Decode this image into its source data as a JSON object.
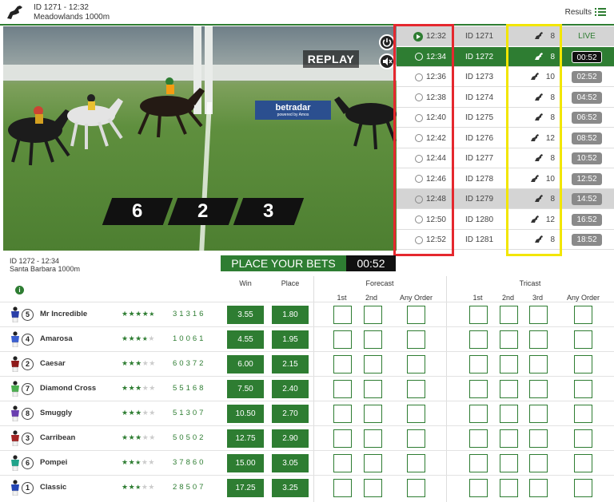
{
  "header": {
    "race_id": "ID 1271 - 12:32",
    "venue": "Meadowlands 1000m",
    "results_label": "Results"
  },
  "video": {
    "replay_label": "REPLAY",
    "placings": [
      "6",
      "2",
      "3"
    ],
    "ad_text": "betradar",
    "ad_subtext": "powered by Amos"
  },
  "schedule": [
    {
      "time": "12:32",
      "id": "ID 1271",
      "runners": "8",
      "status": "LIVE",
      "state": "live"
    },
    {
      "time": "12:34",
      "id": "ID 1272",
      "runners": "8",
      "status": "00:52",
      "state": "current"
    },
    {
      "time": "12:36",
      "id": "ID 1273",
      "runners": "10",
      "status": "02:52",
      "state": "upcoming"
    },
    {
      "time": "12:38",
      "id": "ID 1274",
      "runners": "8",
      "status": "04:52",
      "state": "upcoming"
    },
    {
      "time": "12:40",
      "id": "ID 1275",
      "runners": "8",
      "status": "06:52",
      "state": "upcoming"
    },
    {
      "time": "12:42",
      "id": "ID 1276",
      "runners": "12",
      "status": "08:52",
      "state": "upcoming"
    },
    {
      "time": "12:44",
      "id": "ID 1277",
      "runners": "8",
      "status": "10:52",
      "state": "upcoming"
    },
    {
      "time": "12:46",
      "id": "ID 1278",
      "runners": "10",
      "status": "12:52",
      "state": "upcoming"
    },
    {
      "time": "12:48",
      "id": "ID 1279",
      "runners": "8",
      "status": "14:52",
      "state": "grey"
    },
    {
      "time": "12:50",
      "id": "ID 1280",
      "runners": "12",
      "status": "16:52",
      "state": "upcoming"
    },
    {
      "time": "12:52",
      "id": "ID 1281",
      "runners": "8",
      "status": "18:52",
      "state": "upcoming"
    }
  ],
  "race": {
    "id": "ID 1272 - 12:34",
    "venue": "Santa Barbara 1000m",
    "place_bets_label": "PLACE YOUR BETS",
    "timer": "00:52"
  },
  "columns": {
    "info": "i",
    "win": "Win",
    "place": "Place",
    "forecast": "Forecast",
    "tricast": "Tricast",
    "first": "1st",
    "second": "2nd",
    "third": "3rd",
    "any_order": "Any Order"
  },
  "runners": [
    {
      "num": "5",
      "name": "Mr Incredible",
      "stars": 4.5,
      "form": "31316",
      "win": "3.55",
      "place": "1.80",
      "silk": "#2a3fa8"
    },
    {
      "num": "4",
      "name": "Amarosa",
      "stars": 3.5,
      "form": "10061",
      "win": "4.55",
      "place": "1.95",
      "silk": "#3a5fd0"
    },
    {
      "num": "2",
      "name": "Caesar",
      "stars": 3,
      "form": "60372",
      "win": "6.00",
      "place": "2.15",
      "silk": "#8e1a1a"
    },
    {
      "num": "7",
      "name": "Diamond Cross",
      "stars": 3,
      "form": "55168",
      "win": "7.50",
      "place": "2.40",
      "silk": "#4caf50"
    },
    {
      "num": "8",
      "name": "Smuggly",
      "stars": 3,
      "form": "51307",
      "win": "10.50",
      "place": "2.70",
      "silk": "#6a3fb0"
    },
    {
      "num": "3",
      "name": "Carribean",
      "stars": 3,
      "form": "50502",
      "win": "12.75",
      "place": "2.90",
      "silk": "#a32424"
    },
    {
      "num": "6",
      "name": "Pompei",
      "stars": 2.5,
      "form": "37860",
      "win": "15.00",
      "place": "3.05",
      "silk": "#20a38a"
    },
    {
      "num": "1",
      "name": "Classic",
      "stars": 2.5,
      "form": "28507",
      "win": "17.25",
      "place": "3.25",
      "silk": "#2446b5"
    }
  ],
  "colors": {
    "brand_green": "#2e7d32",
    "highlight_red": "#e5282e",
    "highlight_yellow": "#f2e600"
  }
}
